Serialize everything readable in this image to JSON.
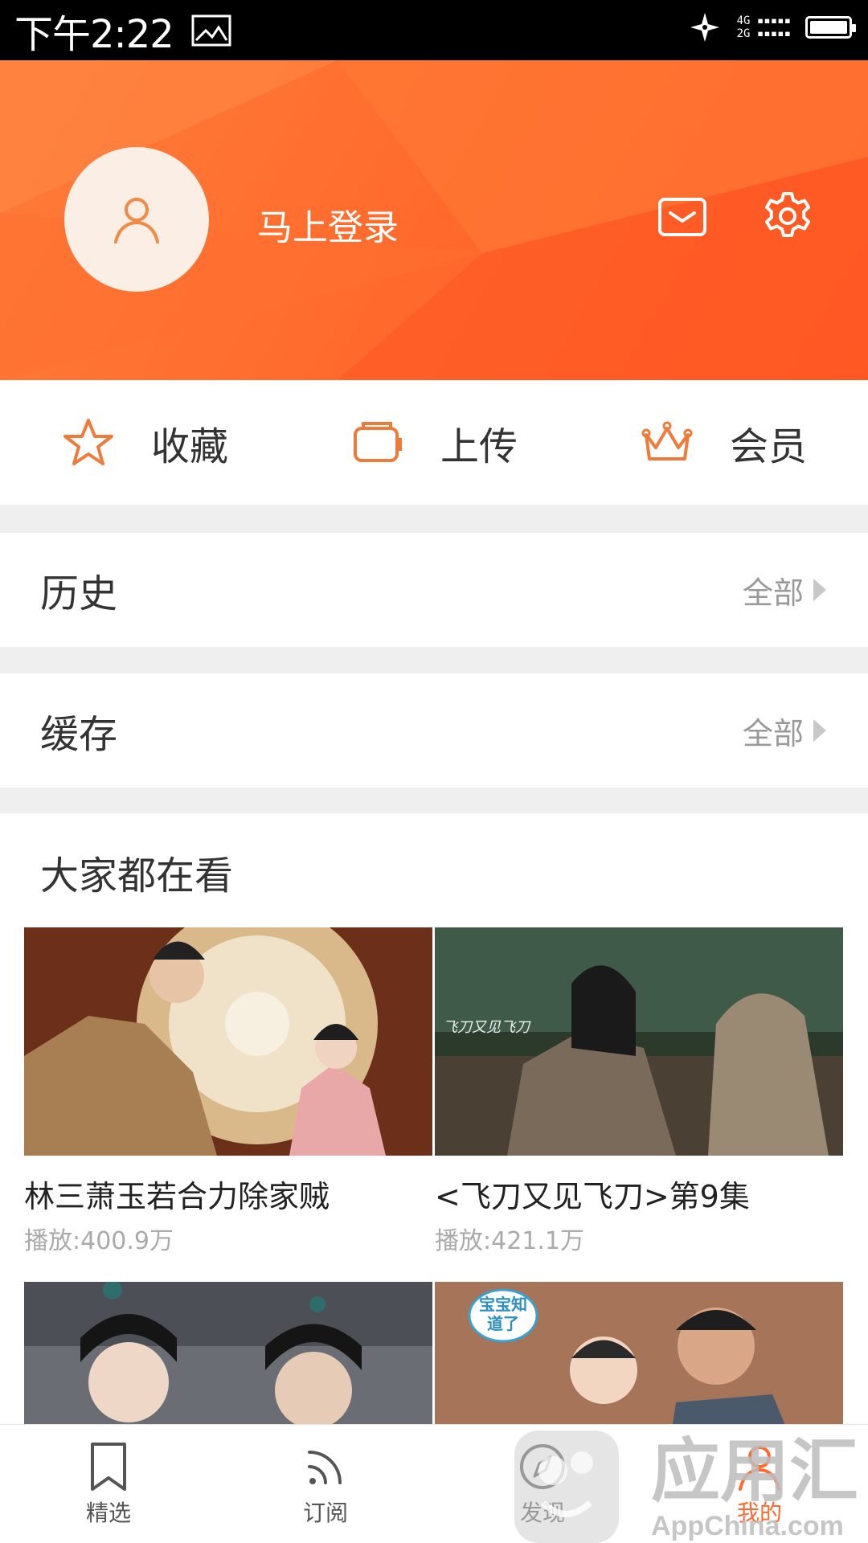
{
  "status_bar": {
    "time": "下午2:22",
    "network": [
      "4G",
      "2G"
    ]
  },
  "header": {
    "login_text": "马上登录"
  },
  "quick_actions": [
    {
      "label": "收藏",
      "icon": "star-icon"
    },
    {
      "label": "上传",
      "icon": "upload-icon"
    },
    {
      "label": "会员",
      "icon": "crown-icon"
    }
  ],
  "history": {
    "title": "历史",
    "all_label": "全部"
  },
  "cache": {
    "title": "缓存",
    "all_label": "全部"
  },
  "popular": {
    "title": "大家都在看",
    "items": [
      {
        "title": "林三萧玉若合力除家贼",
        "plays": "播放:400.9万"
      },
      {
        "title": "<飞刀又见飞刀>第9集",
        "plays": "播放:421.1万",
        "thumb_text": "飞刀又见飞刀"
      },
      {
        "title": "",
        "plays": ""
      },
      {
        "title": "",
        "plays": "",
        "thumb_text": "宝宝知道了"
      }
    ]
  },
  "bottom_nav": [
    {
      "label": "精选",
      "icon": "bookmark-icon"
    },
    {
      "label": "订阅",
      "icon": "rss-icon"
    },
    {
      "label": "发现",
      "icon": "compass-icon"
    },
    {
      "label": "我的",
      "icon": "person-icon",
      "active": true
    }
  ],
  "watermark": {
    "main": "应用汇",
    "sub": "AppChina.com"
  },
  "colors": {
    "accent": "#ff6a2c",
    "header_start": "#ff7d38",
    "header_end": "#ff5a25",
    "background": "#efefef"
  }
}
